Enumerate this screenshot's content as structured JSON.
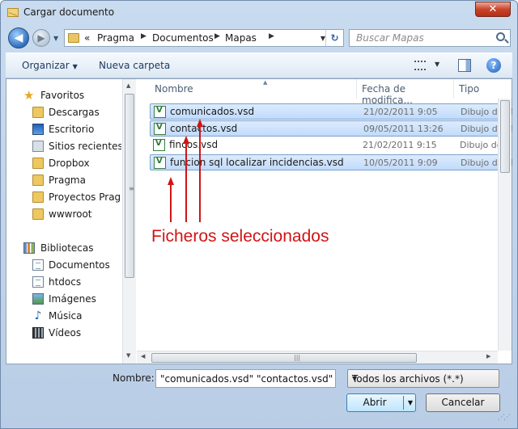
{
  "window": {
    "title": "Cargar documento",
    "close_glyph": "✕"
  },
  "navigation": {
    "back_glyph": "◀",
    "forward_glyph": "▶",
    "breadcrumb_prefix": "«",
    "breadcrumb": [
      "Pragma",
      "Documentos",
      "Mapas"
    ],
    "refresh_glyph": "↻",
    "search_placeholder": "Buscar Mapas"
  },
  "toolbar": {
    "organize": "Organizar",
    "new_folder": "Nueva carpeta",
    "help_glyph": "?"
  },
  "sidebar": {
    "favorites": {
      "label": "Favoritos",
      "items": [
        "Descargas",
        "Escritorio",
        "Sitios recientes",
        "Dropbox",
        "Pragma",
        "Proyectos Pragma",
        "wwwroot"
      ]
    },
    "libraries": {
      "label": "Bibliotecas",
      "items": [
        "Documentos",
        "htdocs",
        "Imágenes",
        "Música",
        "Vídeos"
      ]
    }
  },
  "columns": {
    "name": "Nombre",
    "date": "Fecha de modifica...",
    "type": "Tipo"
  },
  "files": [
    {
      "name": "comunicados.vsd",
      "date": "21/02/2011 9:05",
      "type": "Dibujo de M",
      "selected": true
    },
    {
      "name": "contactos.vsd",
      "date": "09/05/2011 13:26",
      "type": "Dibujo de M",
      "selected": true
    },
    {
      "name": "fincos.vsd",
      "date": "21/02/2011 9:15",
      "type": "Dibujo de M",
      "selected": false
    },
    {
      "name": "funcion sql localizar incidencias.vsd",
      "date": "10/05/2011 9:09",
      "type": "Dibujo de M",
      "selected": true
    }
  ],
  "annotation": "Ficheros seleccionados",
  "footer": {
    "name_label": "Nombre:",
    "name_value": "\"comunicados.vsd\" \"contactos.vsd\" \"f",
    "file_type": "Todos los archivos (*.*)",
    "open_button": "Abrir",
    "cancel_button": "Cancelar"
  },
  "colors": {
    "annotation": "#d11414",
    "selection": "#c1dbfc",
    "title_bar": "#c9dbef"
  }
}
